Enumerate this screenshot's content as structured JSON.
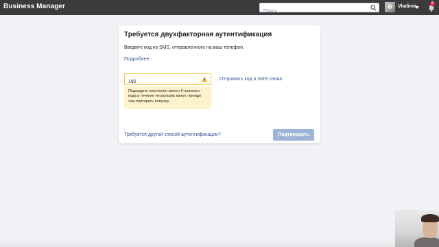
{
  "topbar": {
    "brand": "Business Manager",
    "search_placeholder": "Поиск",
    "username": "Vladimir",
    "notification_count": "5"
  },
  "dialog": {
    "title": "Требуется двухфакторная аутентификация",
    "description": "Введите код из SMS, отправленного на ваш телефон.",
    "more_link": "Подробнее",
    "code_value": "192",
    "tooltip": "Подождите получения своего 6-значного кода в течение нескольких минут, прежде чем повторить попытку.",
    "resend_link": "Отправить код в SMS снова",
    "other_method_link": "Требуется другой способ аутентификации?",
    "confirm_button": "Подтвердить"
  },
  "colors": {
    "topbar_bg": "#3b3b3d",
    "link": "#385898",
    "warning_border": "#f5c33b",
    "tooltip_bg": "#fdf2cc",
    "button_disabled": "#9cb4d8",
    "page_bg": "#f0f2f5"
  },
  "icons": {
    "search": "search-icon",
    "warning": "warning-icon",
    "notifications": "bell-icon",
    "caret": "chevron-down-icon"
  }
}
